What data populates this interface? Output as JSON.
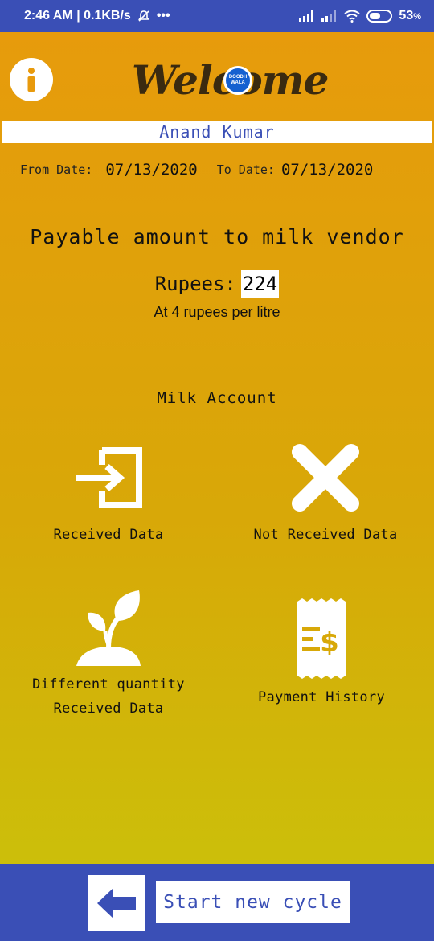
{
  "status_bar": {
    "time_speed": "2:46 AM | 0.1KB/s",
    "more": "•••",
    "battery": "53",
    "battery_unit": "%",
    "battery_level": 0.53
  },
  "header": {
    "logo_text": "Welcome",
    "logo_badge": "DOODH WALA"
  },
  "user_name": "Anand Kumar",
  "dates": {
    "from_label": "From Date:",
    "from_value": "07/13/2020",
    "to_label": "To Date:",
    "to_value": "07/13/2020"
  },
  "payable": {
    "title": "Payable amount to milk vendor",
    "rupees_label": "Rupees:",
    "rupees_value": "224",
    "rate_text": "At 4 rupees per litre"
  },
  "milk_account": {
    "title": "Milk Account",
    "received": "Received Data",
    "not_received": "Not Received Data",
    "different_line1": "Different quantity",
    "different_line2": "Received Data",
    "payment_history": "Payment History"
  },
  "footer": {
    "start_new_cycle": "Start new cycle"
  },
  "colors": {
    "bar_blue": "#3a4fb6",
    "gradient_top": "#e89a0c",
    "gradient_bottom": "#c9c40a"
  }
}
